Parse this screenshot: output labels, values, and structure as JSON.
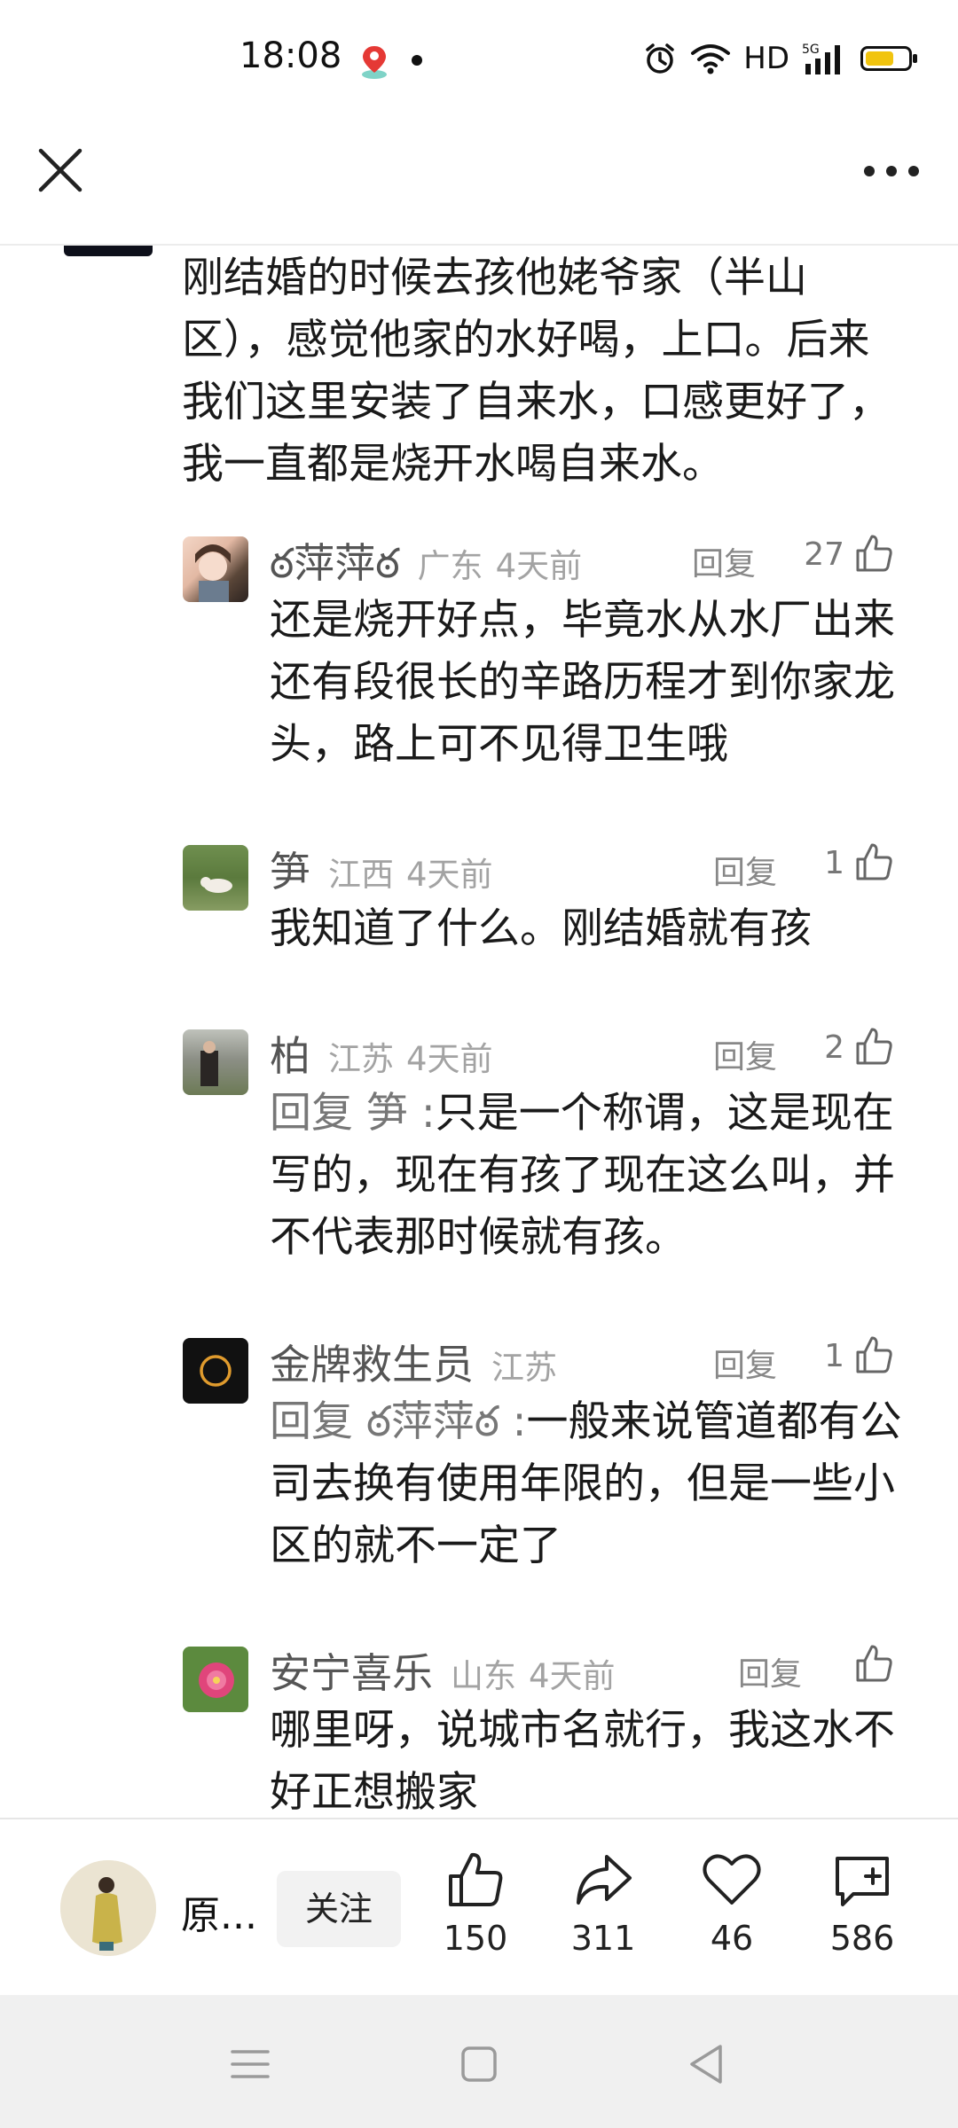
{
  "status": {
    "time": "18:08",
    "network": "HD",
    "cell": "5G"
  },
  "parent_comment": {
    "text": "刚结婚的时候去孩他姥爷家（半山区），感觉他家的水好喝，上口。后来我们这里安装了自来水，口感更好了，我一直都是烧开水喝自来水。"
  },
  "replies": [
    {
      "name": "ఠ萍萍ఠ",
      "region": "广东",
      "time": "4天前",
      "reply_label": "回复",
      "likes": "27",
      "quote_prefix": "",
      "quote_name": "",
      "quote_suffix": "",
      "text": "还是烧开好点，毕竟水从水厂出来还有段很长的辛路历程才到你家龙头，路上可不见得卫生哦"
    },
    {
      "name": "笋",
      "region": "江西",
      "time": "4天前",
      "reply_label": "回复",
      "likes": "1",
      "quote_prefix": "",
      "quote_name": "",
      "quote_suffix": "",
      "text": "我知道了什么。刚结婚就有孩"
    },
    {
      "name": "柏",
      "region": "江苏",
      "time": "4天前",
      "reply_label": "回复",
      "likes": "2",
      "quote_prefix": "回复 ",
      "quote_name": "笋",
      "quote_suffix": " :",
      "text": "只是一个称谓，这是现在写的，现在有孩了现在这么叫，并不代表那时候就有孩。"
    },
    {
      "name": "金牌救生员",
      "region": "江苏",
      "time": "",
      "reply_label": "回复",
      "likes": "1",
      "quote_prefix": "回复 ",
      "quote_name": "ఠ萍萍ఠ",
      "quote_suffix": " :",
      "text": "一般来说管道都有公司去换有使用年限的，但是一些小区的就不一定了"
    },
    {
      "name": "安宁喜乐",
      "region": "山东",
      "time": "4天前",
      "reply_label": "回复",
      "likes": "",
      "quote_prefix": "",
      "quote_name": "",
      "quote_suffix": "",
      "text": "哪里呀，说城市名就行，我这水不好正想搬家"
    }
  ],
  "bottom": {
    "author_name": "原...",
    "follow_label": "关注",
    "like_count": "150",
    "share_count": "311",
    "favorite_count": "46",
    "comment_count": "586"
  },
  "colors": {
    "battery": "#f1c40f",
    "muted": "#a3a3a3",
    "text": "#1a1a1a"
  },
  "icons": [
    "location-icon",
    "alarm-icon",
    "wifi-icon",
    "signal-icon",
    "battery-icon",
    "close-icon",
    "more-icon",
    "thumb-up-icon",
    "share-icon",
    "heart-icon",
    "comment-add-icon",
    "menu-nav-icon",
    "home-nav-icon",
    "back-nav-icon"
  ]
}
